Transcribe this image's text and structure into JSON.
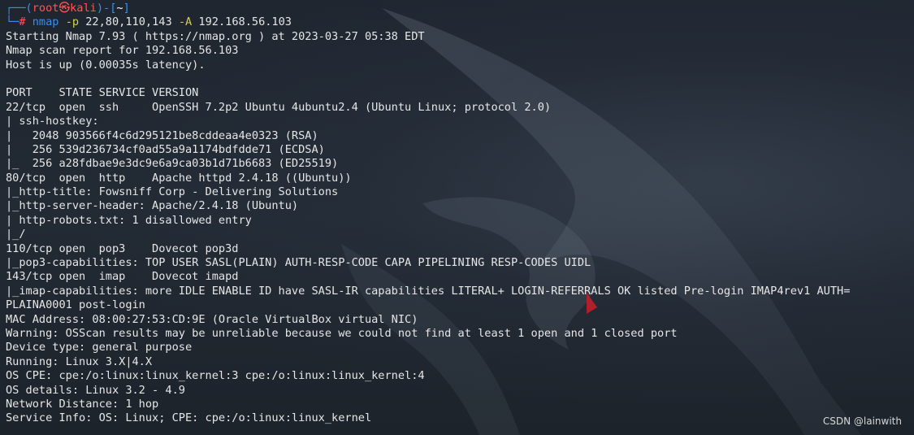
{
  "prompt": {
    "top_open": "┌──(",
    "user": "root",
    "at_symbol": "㉿",
    "host": "kali",
    "mid": ")-[",
    "cwd": "~",
    "top_close": "]",
    "bottom_prefix": "└─",
    "hash": "#",
    "command": "nmap",
    "flag_p": "-p",
    "ports": "22,80,110,143",
    "flag_A": "-A",
    "target": "192.168.56.103"
  },
  "output_lines": [
    "Starting Nmap 7.93 ( https://nmap.org ) at 2023-03-27 05:38 EDT",
    "Nmap scan report for 192.168.56.103",
    "Host is up (0.00035s latency).",
    "",
    "PORT    STATE SERVICE VERSION",
    "22/tcp  open  ssh     OpenSSH 7.2p2 Ubuntu 4ubuntu2.4 (Ubuntu Linux; protocol 2.0)",
    "| ssh-hostkey:",
    "|   2048 903566f4c6d295121be8cddeaa4e0323 (RSA)",
    "|   256 539d236734cf0ad55a9a1174bdfdde71 (ECDSA)",
    "|_  256 a28fdbae9e3dc9e6a9ca03b1d71b6683 (ED25519)",
    "80/tcp  open  http    Apache httpd 2.4.18 ((Ubuntu))",
    "|_http-title: Fowsniff Corp - Delivering Solutions",
    "|_http-server-header: Apache/2.4.18 (Ubuntu)",
    "| http-robots.txt: 1 disallowed entry",
    "|_/",
    "110/tcp open  pop3    Dovecot pop3d",
    "|_pop3-capabilities: TOP USER SASL(PLAIN) AUTH-RESP-CODE CAPA PIPELINING RESP-CODES UIDL",
    "143/tcp open  imap    Dovecot imapd",
    "|_imap-capabilities: more IDLE ENABLE ID have SASL-IR capabilities LITERAL+ LOGIN-REFERRALS OK listed Pre-login IMAP4rev1 AUTH=",
    "PLAINA0001 post-login",
    "MAC Address: 08:00:27:53:CD:9E (Oracle VirtualBox virtual NIC)",
    "Warning: OSScan results may be unreliable because we could not find at least 1 open and 1 closed port",
    "Device type: general purpose",
    "Running: Linux 3.X|4.X",
    "OS CPE: cpe:/o:linux:linux_kernel:3 cpe:/o:linux:linux_kernel:4",
    "OS details: Linux 3.2 - 4.9",
    "Network Distance: 1 hop",
    "Service Info: OS: Linux; CPE: cpe:/o:linux:linux_kernel"
  ],
  "watermark": "CSDN @lainwith",
  "colors": {
    "background": "#1f2630",
    "text": "#e6e6e6",
    "prompt_blue": "#3b8eea",
    "prompt_red": "#ff5555",
    "flag_yellow": "#d3d04f"
  }
}
